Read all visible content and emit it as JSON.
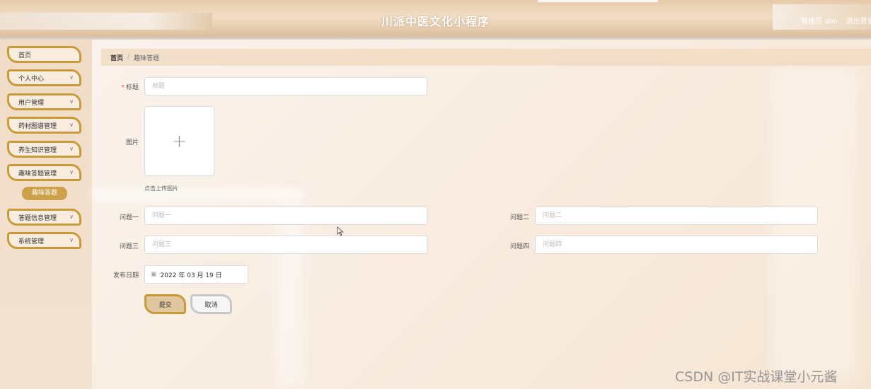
{
  "header": {
    "title": "川派中医文化小程序",
    "user_label": "管理员 abo",
    "logout_label": "退出登录"
  },
  "sidebar": {
    "items": [
      {
        "label": "首页",
        "has_chevron": false
      },
      {
        "label": "个人中心",
        "has_chevron": true
      },
      {
        "label": "用户管理",
        "has_chevron": true
      },
      {
        "label": "药材图谱管理",
        "has_chevron": true
      },
      {
        "label": "养生知识管理",
        "has_chevron": true
      },
      {
        "label": "趣味答题管理",
        "has_chevron": true,
        "expanded": true
      },
      {
        "label": "答题信息管理",
        "has_chevron": true
      },
      {
        "label": "系统管理",
        "has_chevron": true
      }
    ],
    "active_sub_item": "趣味答题"
  },
  "breadcrumb": {
    "home": "首页",
    "separator": "/",
    "current": "趣味答题"
  },
  "form": {
    "title": {
      "label": "标题",
      "placeholder": "标题",
      "required": true
    },
    "image": {
      "label": "图片",
      "upload_hint": "点击上传图片"
    },
    "q1": {
      "label": "问题一",
      "placeholder": "问题一"
    },
    "q2": {
      "label": "问题二",
      "placeholder": "问题二"
    },
    "q3": {
      "label": "问题三",
      "placeholder": "问题三"
    },
    "q4": {
      "label": "问题四",
      "placeholder": "问题四"
    },
    "date": {
      "label": "发布日期",
      "value": "2022 年 03 月 19 日"
    },
    "submit_label": "提交",
    "cancel_label": "取消"
  },
  "watermark": "CSDN @IT实战课堂小元酱",
  "colors": {
    "accent_gold": "#c79a3a",
    "active_sub_bg": "#cda14a",
    "header_bg": "#e6cbaa",
    "required_star": "#e24a4a"
  },
  "icons": {
    "chevron": "chevron-down-icon",
    "upload": "plus-icon",
    "date": "calendar-icon"
  }
}
